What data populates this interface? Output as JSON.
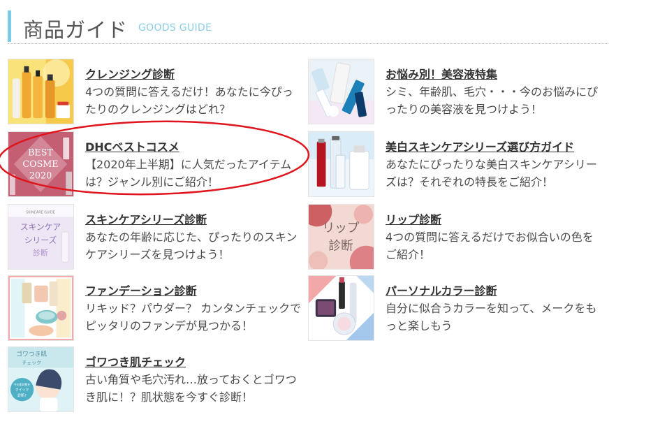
{
  "header": {
    "title": "商品ガイド",
    "subtitle": "GOODS GUIDE",
    "accent_color": "#7dcbe6"
  },
  "items": [
    {
      "title": "クレンジング診断",
      "desc": "4つの質問に答えるだけ！あなたに今ぴったりのクレンジングはどれ？",
      "thumb_icon": "cleansing-products-thumbnail"
    },
    {
      "title": "お悩み別！美容液特集",
      "desc": "シミ、年齢肌、毛穴・・・今のお悩みにぴったりの美容液を見つけよう！",
      "thumb_icon": "serum-products-thumbnail"
    },
    {
      "title": "DHCベストコスメ",
      "desc": "【2020年上半期】に人気だったアイテムは？ジャンル別にご紹介！",
      "thumb_icon": "best-cosme-thumbnail",
      "thumb_text": [
        "BEST",
        "COSME",
        "2020"
      ]
    },
    {
      "title": "美白スキンケアシリーズ選び方ガイド",
      "desc": "あなたにぴったりな美白スキンケアシリーズは？それぞれの特長をご紹介！",
      "thumb_icon": "whitening-skincare-thumbnail"
    },
    {
      "title": "スキンケアシリーズ診断",
      "desc": "あなたの年齢に応じた、ぴったりのスキンケアシリーズを見つけよう！",
      "thumb_icon": "skincare-series-thumbnail",
      "thumb_text": [
        "SKINCARE GUIDE",
        "スキンケア",
        "シリーズ",
        "診断"
      ]
    },
    {
      "title": "リップ診断",
      "desc": "4つの質問に答えるだけでお似合いの色をご紹介！",
      "thumb_icon": "lip-diagnosis-thumbnail",
      "thumb_text": [
        "リップ",
        "診断"
      ]
    },
    {
      "title": "ファンデーション診断",
      "desc": "リキッド？パウダー？ カンタンチェックでピッタリのファンデが見つかる！",
      "thumb_icon": "foundation-thumbnail"
    },
    {
      "title": "パーソナルカラー診断",
      "desc": "自分に似合うカラーを知って、メークをもっと楽しもう",
      "thumb_icon": "personal-color-thumbnail"
    },
    {
      "title": "ゴワつき肌チェック",
      "desc": "古い角質や毛穴汚れ…放っておくとゴワつき肌に！？肌状態を今すぐ診断！",
      "thumb_icon": "rough-skin-thumbnail",
      "thumb_text": [
        "ゴワつき肌",
        "チェック",
        "今の肌状態を",
        "クイック",
        "診断♪"
      ]
    }
  ],
  "annotation": {
    "type": "red-oval-highlight",
    "color": "#e0141c"
  }
}
